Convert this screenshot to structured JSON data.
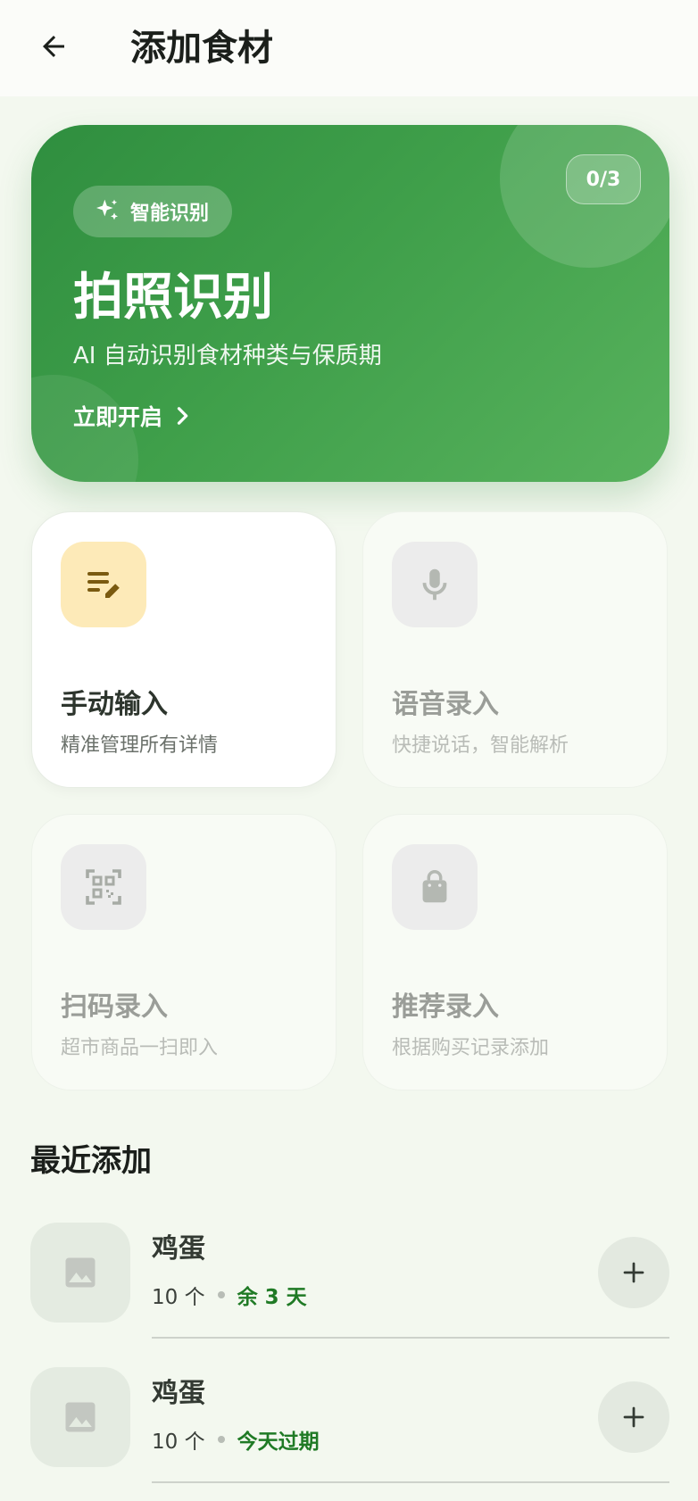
{
  "header": {
    "title": "添加食材",
    "back_icon": "arrow-back-icon"
  },
  "hero": {
    "counter": "0/3",
    "chip_label": "智能识别",
    "chip_icon": "sparkle-icon",
    "title": "拍照识别",
    "subtitle": "AI 自动识别食材种类与保质期",
    "cta_label": "立即开启",
    "cta_icon": "chevron-right-icon",
    "gradient_start": "#2f8e3f",
    "gradient_end": "#58b25d"
  },
  "input_methods": [
    {
      "title": "手动输入",
      "desc": "精准管理所有详情",
      "icon": "edit-note-icon",
      "active": true
    },
    {
      "title": "语音录入",
      "desc": "快捷说话，智能解析",
      "icon": "mic-icon",
      "active": false
    },
    {
      "title": "扫码录入",
      "desc": "超市商品一扫即入",
      "icon": "qr-scan-icon",
      "active": false
    },
    {
      "title": "推荐录入",
      "desc": "根据购买记录添加",
      "icon": "shopping-bag-icon",
      "active": false
    }
  ],
  "recent": {
    "title": "最近添加",
    "items": [
      {
        "name": "鸡蛋",
        "qty": "10 个",
        "status": "余 3 天",
        "thumb_icon": "image-placeholder-icon",
        "add_icon": "plus-icon"
      },
      {
        "name": "鸡蛋",
        "qty": "10 个",
        "status": "今天过期",
        "thumb_icon": "image-placeholder-icon",
        "add_icon": "plus-icon"
      }
    ]
  },
  "colors": {
    "accent_green": "#1f7a25",
    "active_icon_bg": "#fdeab8",
    "active_icon_fg": "#7a5a10",
    "page_bg": "#f3f8ef"
  }
}
